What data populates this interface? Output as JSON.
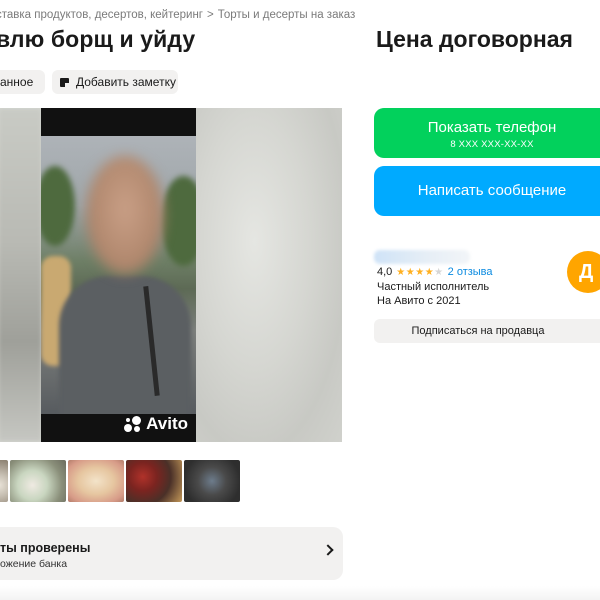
{
  "breadcrumb": {
    "items": [
      "ставка продуктов, десертов, кейтеринг",
      "Торты и десерты на заказ"
    ],
    "separator": ">"
  },
  "listing": {
    "title": "влю борщ и уйду",
    "price": "Цена договорная"
  },
  "actions": {
    "favorite_label": "анное",
    "note_label": "Добавить заметку"
  },
  "gallery": {
    "watermark": "Avito",
    "thumbnail_count": 6
  },
  "verified": {
    "title": "ты проверены",
    "subtitle": "ожение банка"
  },
  "contact": {
    "phone_button": "Показать телефон",
    "phone_masked": "8 XXX XXX-XX-XX",
    "message_button": "Написать сообщение"
  },
  "seller": {
    "rating": "4,0",
    "rating_value": 4,
    "rating_max": 5,
    "reviews": "2 отзыва",
    "type": "Частный исполнитель",
    "since": "На Авито с 2021",
    "avatar_letter": "Д",
    "subscribe_label": "Подписаться на продавца"
  },
  "colors": {
    "phone_button": "#02d15c",
    "message_button": "#00aaff",
    "star": "#ffb021",
    "link": "#0a8ae0",
    "avatar": "#ffa500"
  },
  "icons": {
    "note": "note-icon",
    "chevron": "chevron-right-icon",
    "star": "star-icon"
  }
}
